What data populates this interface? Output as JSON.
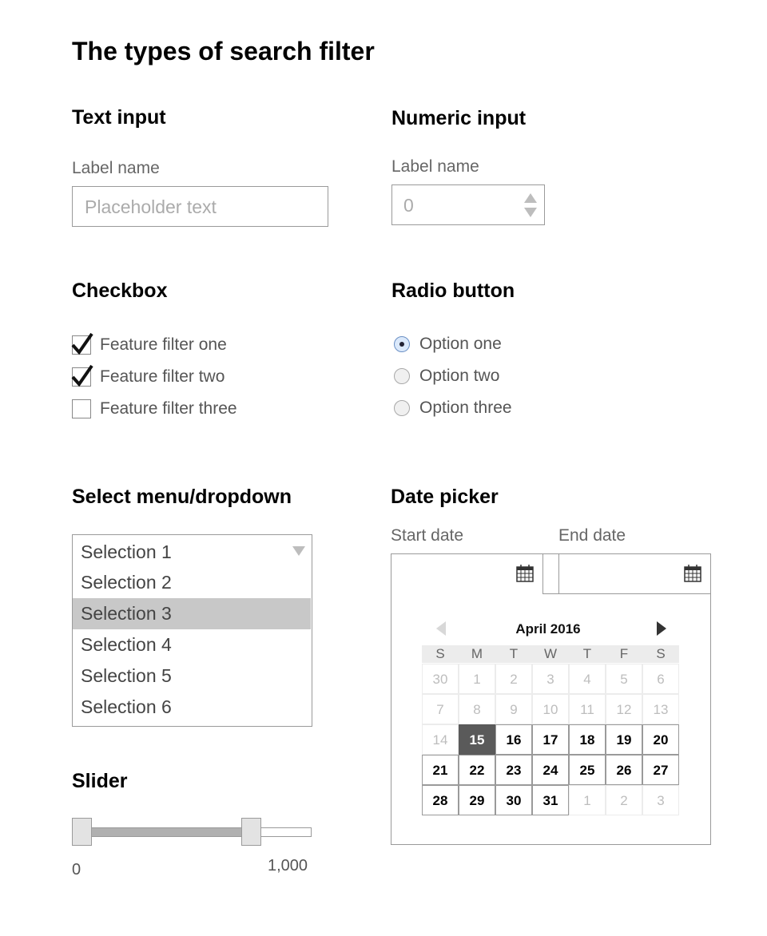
{
  "title": "The types of search filter",
  "text_input": {
    "heading": "Text input",
    "label": "Label name",
    "placeholder": "Placeholder text"
  },
  "numeric_input": {
    "heading": "Numeric input",
    "label": "Label name",
    "value": "0"
  },
  "checkbox": {
    "heading": "Checkbox",
    "items": [
      {
        "label": "Feature filter one",
        "checked": true
      },
      {
        "label": "Feature filter two",
        "checked": true
      },
      {
        "label": "Feature filter three",
        "checked": false
      }
    ]
  },
  "radio": {
    "heading": "Radio button",
    "items": [
      {
        "label": "Option one",
        "selected": true
      },
      {
        "label": "Option two",
        "selected": false
      },
      {
        "label": "Option three",
        "selected": false
      }
    ]
  },
  "dropdown": {
    "heading": "Select menu/dropdown",
    "selected": "Selection 1",
    "options": [
      "Selection 2",
      "Selection 3",
      "Selection 4",
      "Selection 5",
      "Selection 6"
    ],
    "highlighted": "Selection 3"
  },
  "slider": {
    "heading": "Slider",
    "min_label": "0",
    "max_label": "1,000",
    "range_start_fraction": 0,
    "range_end_fraction": 0.77
  },
  "date_picker": {
    "heading": "Date picker",
    "start_label": "Start date",
    "end_label": "End date",
    "month_label": "April 2016",
    "weekdays": [
      "S",
      "M",
      "T",
      "W",
      "T",
      "F",
      "S"
    ],
    "days": [
      [
        {
          "d": "30",
          "s": "muted"
        },
        {
          "d": "1",
          "s": "muted"
        },
        {
          "d": "2",
          "s": "muted"
        },
        {
          "d": "3",
          "s": "muted"
        },
        {
          "d": "4",
          "s": "muted"
        },
        {
          "d": "5",
          "s": "muted"
        },
        {
          "d": "6",
          "s": "muted"
        }
      ],
      [
        {
          "d": "7",
          "s": "muted"
        },
        {
          "d": "8",
          "s": "muted"
        },
        {
          "d": "9",
          "s": "muted"
        },
        {
          "d": "10",
          "s": "muted"
        },
        {
          "d": "11",
          "s": "muted"
        },
        {
          "d": "12",
          "s": "muted"
        },
        {
          "d": "13",
          "s": "muted"
        }
      ],
      [
        {
          "d": "14",
          "s": "muted"
        },
        {
          "d": "15",
          "s": "today"
        },
        {
          "d": "16",
          "s": "curr"
        },
        {
          "d": "17",
          "s": "curr"
        },
        {
          "d": "18",
          "s": "curr"
        },
        {
          "d": "19",
          "s": "curr"
        },
        {
          "d": "20",
          "s": "curr"
        }
      ],
      [
        {
          "d": "21",
          "s": "curr"
        },
        {
          "d": "22",
          "s": "curr"
        },
        {
          "d": "23",
          "s": "curr"
        },
        {
          "d": "24",
          "s": "curr"
        },
        {
          "d": "25",
          "s": "curr"
        },
        {
          "d": "26",
          "s": "curr"
        },
        {
          "d": "27",
          "s": "curr"
        }
      ],
      [
        {
          "d": "28",
          "s": "curr"
        },
        {
          "d": "29",
          "s": "curr"
        },
        {
          "d": "30",
          "s": "curr"
        },
        {
          "d": "31",
          "s": "curr"
        },
        {
          "d": "1",
          "s": "muted"
        },
        {
          "d": "2",
          "s": "muted"
        },
        {
          "d": "3",
          "s": "muted"
        }
      ]
    ]
  },
  "colors": {
    "highlight": "#c8c8c8",
    "today": "#5a5a5a",
    "radio_selected": "#dbe9fb"
  }
}
